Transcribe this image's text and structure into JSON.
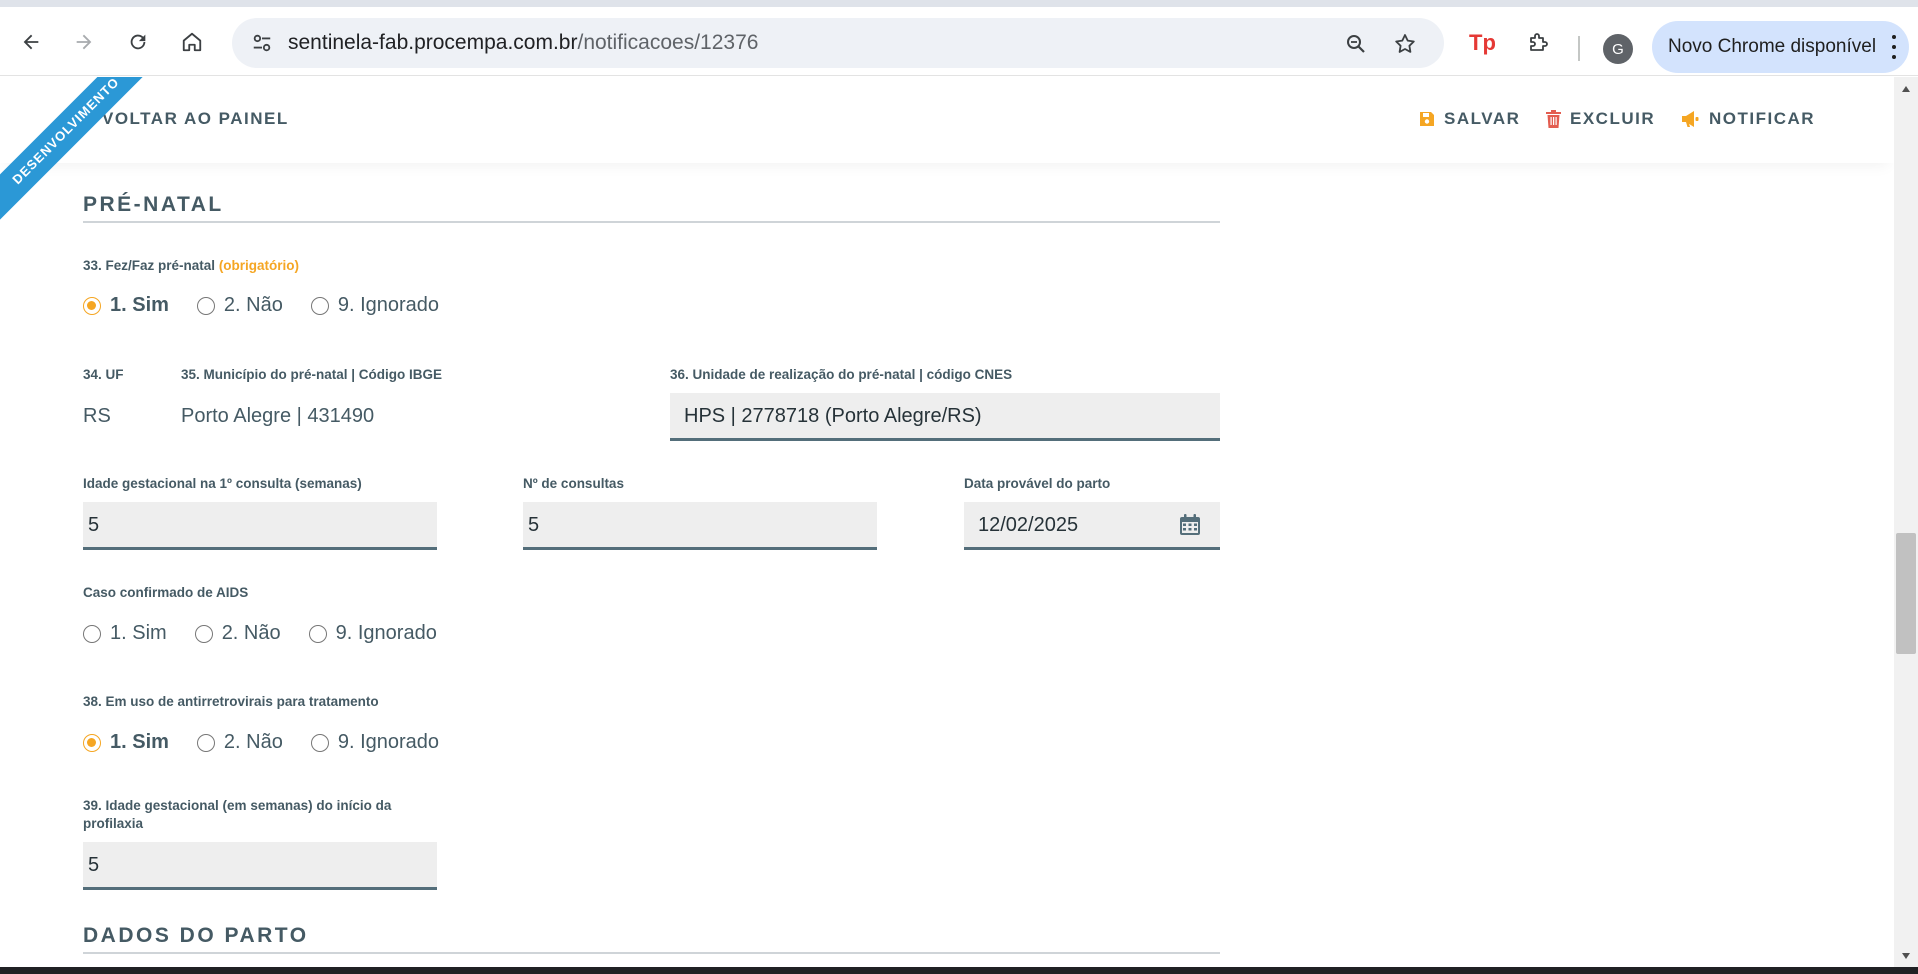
{
  "browser": {
    "url_host": "sentinela-fab.procempa.com.br",
    "url_path": "/notificacoes/12376",
    "avatar_letter": "G",
    "update_label": "Novo Chrome disponível",
    "icons": [
      "back-arrow-icon",
      "forward-arrow-icon",
      "reload-icon",
      "home-icon",
      "site-settings-icon",
      "zoom-icon",
      "star-icon",
      "tp-extension-icon",
      "puzzle-icon",
      "kebab-menu-icon"
    ]
  },
  "ribbon": {
    "label": "DESENVOLVIMENTO"
  },
  "actions": {
    "back": "VOLTAR AO PAINEL",
    "save": "SALVAR",
    "delete": "EXCLUIR",
    "notify": "NOTIFICAR"
  },
  "colors": {
    "accent": "#f5a623",
    "danger": "#e35d50",
    "text": "#455a64",
    "ribbon": "#2b98d6"
  },
  "prenatal": {
    "title": "PRÉ-NATAL",
    "q33": {
      "label": "33. Fez/Faz pré-natal",
      "required": "(obrigatório)",
      "options": [
        "1. Sim",
        "2. Não",
        "9. Ignorado"
      ],
      "selected": "1. Sim"
    },
    "uf": {
      "label": "34. UF",
      "value": "RS"
    },
    "municipio": {
      "label": "35. Município do pré-natal | Código IBGE",
      "value": "Porto Alegre | 431490"
    },
    "unidade": {
      "label": "36. Unidade de realização do pré-natal | código CNES",
      "value": "HPS | 2778718  (Porto Alegre/RS)"
    },
    "idade_gest": {
      "label": "Idade gestacional na 1º consulta (semanas)",
      "value": "5"
    },
    "consultas": {
      "label": "Nº de consultas",
      "value": "5"
    },
    "data_parto": {
      "label": "Data provável do parto",
      "value": "12/02/2025"
    },
    "aids": {
      "label": "Caso confirmado de AIDS",
      "options": [
        "1. Sim",
        "2. Não",
        "9. Ignorado"
      ],
      "selected": ""
    },
    "q38": {
      "label": "38. Em uso de antirretrovirais para tratamento",
      "options": [
        "1. Sim",
        "2. Não",
        "9. Ignorado"
      ],
      "selected": "1. Sim"
    },
    "q39": {
      "label": "39. Idade gestacional (em semanas) do início da profilaxia",
      "value": "5"
    }
  },
  "parto": {
    "title": "DADOS DO PARTO"
  }
}
